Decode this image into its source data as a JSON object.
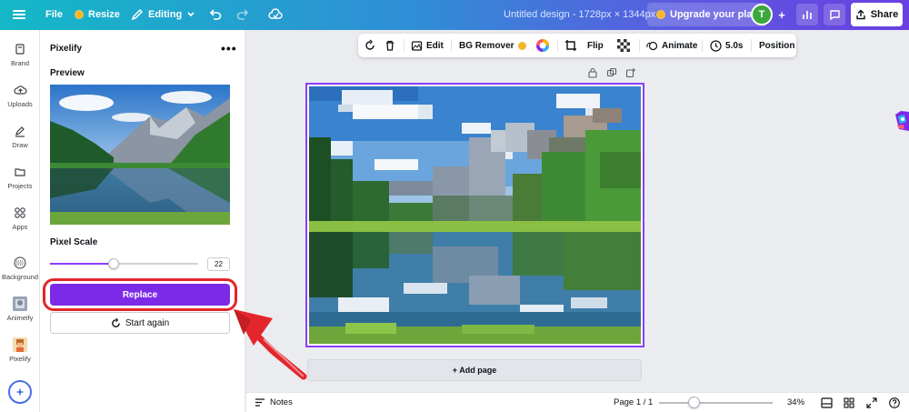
{
  "topbar": {
    "file_label": "File",
    "resize_label": "Resize",
    "editing_label": "Editing",
    "design_title": "Untitled design - 1728px × 1344px",
    "upgrade_label": "Upgrade your plan",
    "avatar_letter": "T",
    "share_label": "Share"
  },
  "rail": {
    "items": [
      {
        "label": "Brand",
        "icon": "brand-icon"
      },
      {
        "label": "Uploads",
        "icon": "upload-cloud-icon"
      },
      {
        "label": "Draw",
        "icon": "pen-icon"
      },
      {
        "label": "Projects",
        "icon": "folder-icon"
      },
      {
        "label": "Apps",
        "icon": "apps-grid-icon"
      },
      {
        "label": "Background",
        "icon": "background-pattern-icon"
      },
      {
        "label": "Animeify",
        "icon": "animeify-app-icon"
      },
      {
        "label": "Pixelify",
        "icon": "pixelify-app-icon"
      }
    ]
  },
  "panel": {
    "title": "Pixelify",
    "preview_label": "Preview",
    "pixel_scale_label": "Pixel Scale",
    "pixel_scale_value": "22",
    "pixel_scale_fraction": 0.43,
    "replace_label": "Replace",
    "start_again_label": "Start again"
  },
  "toolbar": {
    "edit_label": "Edit",
    "bg_remover_label": "BG Remover",
    "flip_label": "Flip",
    "animate_label": "Animate",
    "duration_label": "5.0s",
    "position_label": "Position"
  },
  "canvas": {
    "add_page_label": "+ Add page"
  },
  "bottombar": {
    "notes_label": "Notes",
    "page_label": "Page 1 / 1",
    "zoom_label": "34%"
  },
  "colors": {
    "accent": "#7d2ae8",
    "highlight": "#e3262b",
    "selection": "#8b3dff"
  }
}
